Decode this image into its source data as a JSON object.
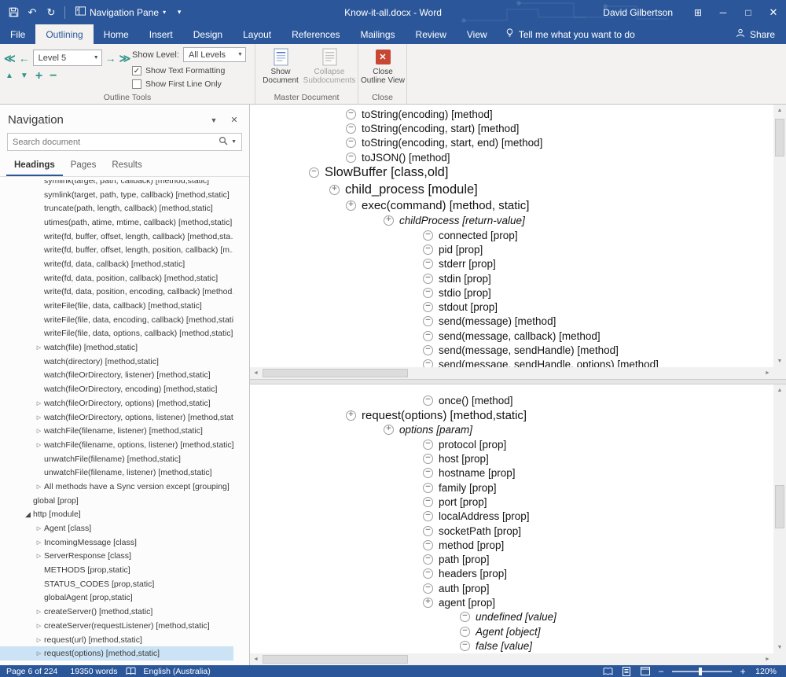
{
  "titlebar": {
    "title": "Know-it-all.docx - Word",
    "user": "David Gilbertson",
    "nav_pane_label": "Navigation Pane"
  },
  "ribbon": {
    "tabs": [
      {
        "label": "File",
        "active": false
      },
      {
        "label": "Outlining",
        "active": true
      },
      {
        "label": "Home",
        "active": false
      },
      {
        "label": "Insert",
        "active": false
      },
      {
        "label": "Design",
        "active": false
      },
      {
        "label": "Layout",
        "active": false
      },
      {
        "label": "References",
        "active": false
      },
      {
        "label": "Mailings",
        "active": false
      },
      {
        "label": "Review",
        "active": false
      },
      {
        "label": "View",
        "active": false
      }
    ],
    "tell_me": "Tell me what you want to do",
    "share": "Share",
    "outline_tools": {
      "group_label": "Outline Tools",
      "level_value": "Level 5",
      "show_level_label": "Show Level:",
      "show_level_value": "All Levels",
      "show_text_formatting": "Show Text Formatting",
      "show_text_formatting_checked": true,
      "show_first_line_only": "Show First Line Only",
      "show_first_line_only_checked": false
    },
    "master_document": {
      "group_label": "Master Document",
      "show_document": "Show Document",
      "collapse_subdocuments": "Collapse Subdocuments"
    },
    "close_group": {
      "group_label": "Close",
      "close_outline_view": "Close Outline View"
    }
  },
  "navigation": {
    "title": "Navigation",
    "search_placeholder": "Search document",
    "tabs": [
      {
        "label": "Headings",
        "active": true
      },
      {
        "label": "Pages",
        "active": false
      },
      {
        "label": "Results",
        "active": false
      }
    ],
    "items": [
      {
        "t": "symlink(target, path, callback) [method,static]",
        "chev": "none",
        "ind": 2
      },
      {
        "t": "symlink(target, path, type, callback) [method,static]",
        "chev": "none",
        "ind": 2
      },
      {
        "t": "truncate(path, length, callback) [method,static]",
        "chev": "none",
        "ind": 2
      },
      {
        "t": "utimes(path, atime, mtime, callback) [method,static]",
        "chev": "none",
        "ind": 2
      },
      {
        "t": "write(fd, buffer, offset, length, callback) [method,sta…",
        "chev": "none",
        "ind": 2
      },
      {
        "t": "write(fd, buffer, offset, length, position, callback) [m…",
        "chev": "none",
        "ind": 2
      },
      {
        "t": "write(fd, data, callback) [method,static]",
        "chev": "none",
        "ind": 2
      },
      {
        "t": "write(fd, data, position, callback) [method,static]",
        "chev": "none",
        "ind": 2
      },
      {
        "t": "write(fd, data, position, encoding, callback) [method…",
        "chev": "none",
        "ind": 2
      },
      {
        "t": "writeFile(file, data, callback) [method,static]",
        "chev": "none",
        "ind": 2
      },
      {
        "t": "writeFile(file, data, encoding, callback) [method,static]",
        "chev": "none",
        "ind": 2
      },
      {
        "t": "writeFile(file, data, options, callback) [method,static]",
        "chev": "none",
        "ind": 2
      },
      {
        "t": "watch(file) [method,static]",
        "chev": "right",
        "ind": 2
      },
      {
        "t": "watch(directory) [method,static]",
        "chev": "none",
        "ind": 2
      },
      {
        "t": "watch(fileOrDirectory, listener) [method,static]",
        "chev": "none",
        "ind": 2
      },
      {
        "t": "watch(fileOrDirectory, encoding) [method,static]",
        "chev": "none",
        "ind": 2
      },
      {
        "t": "watch(fileOrDirectory, options) [method,static]",
        "chev": "right",
        "ind": 2
      },
      {
        "t": "watch(fileOrDirectory, options, listener) [method,stat…",
        "chev": "right",
        "ind": 2
      },
      {
        "t": "watchFile(filename, listener) [method,static]",
        "chev": "right",
        "ind": 2
      },
      {
        "t": "watchFile(filename, options, listener) [method,static]",
        "chev": "right",
        "ind": 2
      },
      {
        "t": "unwatchFile(filename) [method,static]",
        "chev": "none",
        "ind": 2
      },
      {
        "t": "unwatchFile(filename, listener) [method,static]",
        "chev": "none",
        "ind": 2
      },
      {
        "t": "All methods have a Sync version except [grouping]",
        "chev": "right",
        "ind": 2
      },
      {
        "t": "global [prop]",
        "chev": "none",
        "ind": 1
      },
      {
        "t": "http [module]",
        "chev": "down",
        "ind": 1
      },
      {
        "t": "Agent [class]",
        "chev": "right",
        "ind": 2
      },
      {
        "t": "IncomingMessage [class]",
        "chev": "right",
        "ind": 2
      },
      {
        "t": "ServerResponse [class]",
        "chev": "right",
        "ind": 2
      },
      {
        "t": "METHODS [prop,static]",
        "chev": "none",
        "ind": 2
      },
      {
        "t": "STATUS_CODES [prop,static]",
        "chev": "none",
        "ind": 2
      },
      {
        "t": "globalAgent [prop,static]",
        "chev": "none",
        "ind": 2
      },
      {
        "t": "createServer() [method,static]",
        "chev": "right",
        "ind": 2
      },
      {
        "t": "createServer(requestListener) [method,static]",
        "chev": "right",
        "ind": 2
      },
      {
        "t": "request(url) [method,static]",
        "chev": "right",
        "ind": 2
      },
      {
        "t": "request(options) [method,static]",
        "chev": "right",
        "ind": 2,
        "sel": true
      }
    ]
  },
  "outline": {
    "top": [
      {
        "ic": "m",
        "ind": 2,
        "t": "toString(encoding)",
        "tag": "[method]",
        "cls": "sm"
      },
      {
        "ic": "m",
        "ind": 2,
        "t": "toString(encoding, start)",
        "tag": "[method]",
        "cls": "sm"
      },
      {
        "ic": "m",
        "ind": 2,
        "t": "toString(encoding, start, end)",
        "tag": "[method]",
        "cls": "sm"
      },
      {
        "ic": "m",
        "ind": 2,
        "t": "toJSON()",
        "tag": "[method]",
        "cls": "sm"
      },
      {
        "ic": "m",
        "ind": 0,
        "t": "SlowBuffer",
        "tag": "[class,old]",
        "cls": "lg"
      },
      {
        "ic": "p",
        "ind": 1,
        "t": "child_process",
        "tag": "[module]",
        "cls": "lg"
      },
      {
        "ic": "p",
        "ind": 2,
        "t": "exec(command)",
        "tag": "[method, static]",
        "cls": "md"
      },
      {
        "ic": "p",
        "ind": 3,
        "t": "childProcess",
        "tag": "[return-value]",
        "cls": "sm",
        "it": true
      },
      {
        "ic": "m",
        "ind": 4,
        "t": "connected",
        "tag": "[prop]",
        "cls": "sm"
      },
      {
        "ic": "m",
        "ind": 4,
        "t": "pid",
        "tag": "[prop]",
        "cls": "sm"
      },
      {
        "ic": "m",
        "ind": 4,
        "t": "stderr",
        "tag": "[prop]",
        "cls": "sm"
      },
      {
        "ic": "m",
        "ind": 4,
        "t": "stdin",
        "tag": "[prop]",
        "cls": "sm"
      },
      {
        "ic": "m",
        "ind": 4,
        "t": "stdio",
        "tag": "[prop]",
        "cls": "sm"
      },
      {
        "ic": "m",
        "ind": 4,
        "t": "stdout",
        "tag": "[prop]",
        "cls": "sm"
      },
      {
        "ic": "m",
        "ind": 4,
        "t": "send(message)",
        "tag": "[method]",
        "cls": "sm"
      },
      {
        "ic": "m",
        "ind": 4,
        "t": "send(message, callback)",
        "tag": "[method]",
        "cls": "sm"
      },
      {
        "ic": "m",
        "ind": 4,
        "t": "send(message, sendHandle)",
        "tag": "[method]",
        "cls": "sm"
      },
      {
        "ic": "m",
        "ind": 4,
        "t": "send(message, sendHandle, options)",
        "tag": "[method]",
        "cls": "sm"
      }
    ],
    "bottom": [
      {
        "ic": "m",
        "ind": 4,
        "t": "once()",
        "tag": "[method]",
        "cls": "sm"
      },
      {
        "ic": "p",
        "ind": 2,
        "t": "request(options)",
        "tag": "[method,static]",
        "cls": "md"
      },
      {
        "ic": "p",
        "ind": 3,
        "t": "options",
        "tag": "[param]",
        "cls": "sm",
        "it": true
      },
      {
        "ic": "m",
        "ind": 4,
        "t": "protocol",
        "tag": "[prop]",
        "cls": "sm"
      },
      {
        "ic": "m",
        "ind": 4,
        "t": "host",
        "tag": "[prop]",
        "cls": "sm"
      },
      {
        "ic": "m",
        "ind": 4,
        "t": "hostname",
        "tag": "[prop]",
        "cls": "sm"
      },
      {
        "ic": "m",
        "ind": 4,
        "t": "family",
        "tag": "[prop]",
        "cls": "sm"
      },
      {
        "ic": "m",
        "ind": 4,
        "t": "port",
        "tag": "[prop]",
        "cls": "sm"
      },
      {
        "ic": "m",
        "ind": 4,
        "t": "localAddress",
        "tag": "[prop]",
        "cls": "sm"
      },
      {
        "ic": "m",
        "ind": 4,
        "t": "socketPath",
        "tag": "[prop]",
        "cls": "sm"
      },
      {
        "ic": "m",
        "ind": 4,
        "t": "method",
        "tag": "[prop]",
        "cls": "sm"
      },
      {
        "ic": "m",
        "ind": 4,
        "t": "path",
        "tag": "[prop]",
        "cls": "sm"
      },
      {
        "ic": "m",
        "ind": 4,
        "t": "headers",
        "tag": "[prop]",
        "cls": "sm"
      },
      {
        "ic": "m",
        "ind": 4,
        "t": "auth",
        "tag": "[prop]",
        "cls": "sm"
      },
      {
        "ic": "p",
        "ind": 4,
        "t": "agent",
        "tag": "[prop]",
        "cls": "sm"
      },
      {
        "ic": "m",
        "ind": 5,
        "t": "undefined",
        "tag": "[value]",
        "cls": "sm",
        "it": true
      },
      {
        "ic": "m",
        "ind": 5,
        "t": "Agent",
        "tag": "[object]",
        "cls": "sm",
        "it": true
      },
      {
        "ic": "m",
        "ind": 5,
        "t": "false",
        "tag": "[value]",
        "cls": "sm",
        "it": true
      },
      {
        "ic": "m",
        "ind": 4,
        "t": "",
        "tag": "",
        "cls": "sm"
      }
    ]
  },
  "statusbar": {
    "page": "Page 6 of 224",
    "words": "19350 words",
    "language": "English (Australia)",
    "zoom": "120%"
  }
}
